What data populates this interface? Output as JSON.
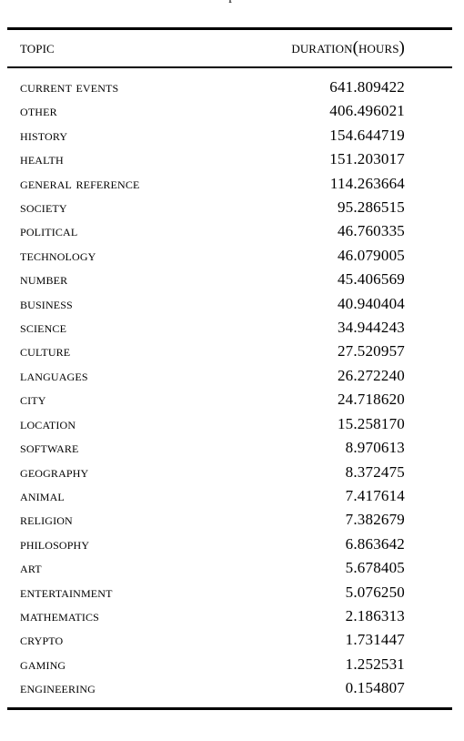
{
  "caption_fragment": "p",
  "table": {
    "columns": [
      {
        "key": "topic",
        "label": "Topic",
        "align": "left"
      },
      {
        "key": "duration",
        "label": "Duration(hours)",
        "align": "right"
      }
    ],
    "rows": [
      {
        "topic": "Current Events",
        "duration": "641.809422"
      },
      {
        "topic": "Other",
        "duration": "406.496021"
      },
      {
        "topic": "History",
        "duration": "154.644719"
      },
      {
        "topic": "Health",
        "duration": "151.203017"
      },
      {
        "topic": "General Reference",
        "duration": "114.263664"
      },
      {
        "topic": "Society",
        "duration": "95.286515"
      },
      {
        "topic": "Political",
        "duration": "46.760335"
      },
      {
        "topic": "Technology",
        "duration": "46.079005"
      },
      {
        "topic": "Number",
        "duration": "45.406569"
      },
      {
        "topic": "Business",
        "duration": "40.940404"
      },
      {
        "topic": "Science",
        "duration": "34.944243"
      },
      {
        "topic": "Culture",
        "duration": "27.520957"
      },
      {
        "topic": "Languages",
        "duration": "26.272240"
      },
      {
        "topic": "City",
        "duration": "24.718620"
      },
      {
        "topic": "Location",
        "duration": "15.258170"
      },
      {
        "topic": "Software",
        "duration": "8.970613"
      },
      {
        "topic": "Geography",
        "duration": "8.372475"
      },
      {
        "topic": "Animal",
        "duration": "7.417614"
      },
      {
        "topic": "Religion",
        "duration": "7.382679"
      },
      {
        "topic": "Philosophy",
        "duration": "6.863642"
      },
      {
        "topic": "Art",
        "duration": "5.678405"
      },
      {
        "topic": "Entertainment",
        "duration": "5.076250"
      },
      {
        "topic": "Mathematics",
        "duration": "2.186313"
      },
      {
        "topic": "Crypto",
        "duration": "1.731447"
      },
      {
        "topic": "Gaming",
        "duration": "1.252531"
      },
      {
        "topic": "Engineering",
        "duration": "0.154807"
      }
    ]
  },
  "chart_data": {
    "type": "table",
    "title": "",
    "xlabel": "Topic",
    "ylabel": "Duration(hours)",
    "categories": [
      "Current Events",
      "Other",
      "History",
      "Health",
      "General Reference",
      "Society",
      "Political",
      "Technology",
      "Number",
      "Business",
      "Science",
      "Culture",
      "Languages",
      "City",
      "Location",
      "Software",
      "Geography",
      "Animal",
      "Religion",
      "Philosophy",
      "Art",
      "Entertainment",
      "Mathematics",
      "Crypto",
      "Gaming",
      "Engineering"
    ],
    "values": [
      641.809422,
      406.496021,
      154.644719,
      151.203017,
      114.263664,
      95.286515,
      46.760335,
      46.079005,
      45.406569,
      40.940404,
      34.944243,
      27.520957,
      26.27224,
      24.71862,
      15.25817,
      8.970613,
      8.372475,
      7.417614,
      7.382679,
      6.863642,
      5.678405,
      5.07625,
      2.186313,
      1.731447,
      1.252531,
      0.154807
    ]
  }
}
